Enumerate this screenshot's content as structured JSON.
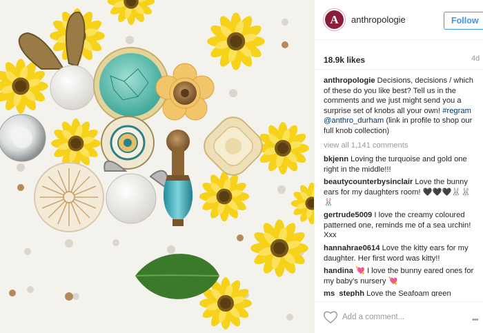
{
  "post": {
    "username": "anthropologie",
    "avatar_letter": "A",
    "follow_label": "Follow",
    "likes": "18.9k likes",
    "time_ago": "4d",
    "caption_user": "anthropologie",
    "caption_text_1": " Decisions, decisions / which of these do you like best? Tell us in the comments and we just might send you a surprise set of knobs all your own! ",
    "caption_tag_1": "#regram",
    "caption_space": " ",
    "caption_tag_2": "@anthro_durham",
    "caption_text_2": " (link in profile to shop our full knob collection)",
    "view_all": "view all 1,141 comments",
    "comments": [
      {
        "user": "bkjenn",
        "text": " Loving the turquoise and gold one right in the middle!!!"
      },
      {
        "user": "beautycounterbysinclair",
        "text": " Love the bunny ears for my daughters room! 🖤🖤🖤🐰🐰🐰"
      },
      {
        "user": "gertrude5009",
        "text": " I love the creamy coloured patterned one, reminds me of a sea urchin! Xxx"
      },
      {
        "user": "hannahrae0614",
        "text": " Love the kitty ears for my daughter. Her first word was kitty!!"
      },
      {
        "user": "handina",
        "text": " 💘 I love the bunny eared ones for my baby's nursery 💘"
      },
      {
        "user": "ms_stephh",
        "text": " Love the Seafoam green"
      }
    ],
    "add_comment_placeholder": "Add a comment...",
    "more_label": "•••",
    "colors": {
      "follow_blue": "#3897f0",
      "hashtag": "#003569",
      "avatar_bg": "#8c1d3a"
    },
    "icons": {
      "heart": "heart-icon",
      "more": "more-options-icon"
    }
  }
}
